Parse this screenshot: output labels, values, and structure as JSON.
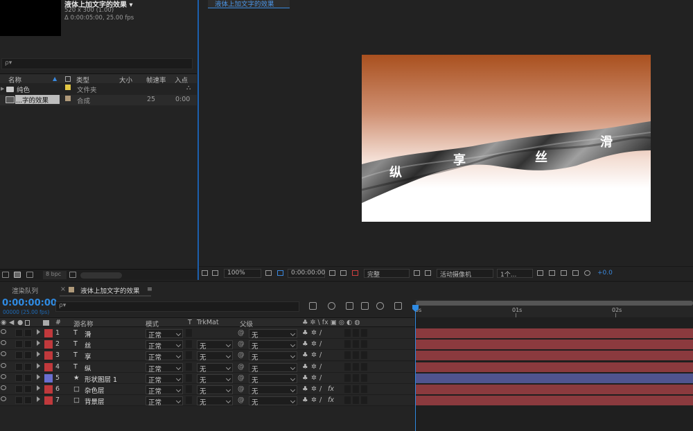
{
  "project": {
    "comp_title": "液体上加文字的效果 ▾",
    "comp_size": "520 x 300 (1.00)",
    "comp_duration": "Δ 0:00:05:00, 25.00 fps",
    "search_placeholder": "ρ▾",
    "headers": {
      "name": "名称",
      "type": "类型",
      "size": "大小",
      "fps": "帧速率",
      "in": "入点"
    },
    "items": [
      {
        "name": "纯色",
        "type": "文件夹",
        "fps": "",
        "in": "",
        "color": "#e3c744"
      },
      {
        "name": "...字的效果",
        "type": "合成",
        "fps": "25",
        "in": "0:00",
        "color": "#b09a7a"
      }
    ],
    "bpc": "8 bpc"
  },
  "viewer": {
    "tab": "液体上加文字的效果",
    "zoom": "100%",
    "timecode": "0:00:00:00",
    "resolution": "完整",
    "camera": "活动摄像机",
    "views": "1个...",
    "exposure": "+0.0",
    "canvas_chars": [
      "纵",
      "享",
      "丝",
      "滑"
    ]
  },
  "timeline": {
    "tabs": {
      "render_queue": "渲染队列",
      "comp": "液体上加文字的效果",
      "menu": "≡",
      "close": "×"
    },
    "current_time": "0:00:00:00",
    "fps_label": "00000 (25.00 fps)",
    "search_placeholder": "ρ▾",
    "headers": {
      "num": "#",
      "source": "源名称",
      "mode": "模式",
      "t": "T",
      "trkmat": "TrkMat",
      "parent": "父级"
    },
    "ruler": [
      "0s",
      "01s",
      "02s"
    ],
    "layers": [
      {
        "num": "1",
        "kind": "T",
        "name": "滑",
        "mode": "正常",
        "trkmat": "",
        "parent": "无",
        "color": "#c0393c",
        "bar": "#8b3a3e"
      },
      {
        "num": "2",
        "kind": "T",
        "name": "丝",
        "mode": "正常",
        "trkmat": "无",
        "parent": "无",
        "color": "#c0393c",
        "bar": "#8b3a3e"
      },
      {
        "num": "3",
        "kind": "T",
        "name": "享",
        "mode": "正常",
        "trkmat": "无",
        "parent": "无",
        "color": "#c0393c",
        "bar": "#8b3a3e"
      },
      {
        "num": "4",
        "kind": "T",
        "name": "纵",
        "mode": "正常",
        "trkmat": "无",
        "parent": "无",
        "color": "#c0393c",
        "bar": "#8b3a3e"
      },
      {
        "num": "5",
        "kind": "★",
        "name": "形状图层 1",
        "mode": "正常",
        "trkmat": "无",
        "parent": "无",
        "color": "#6a6fd0",
        "bar": "#50548f"
      },
      {
        "num": "6",
        "kind": "□",
        "name": "杂色层",
        "mode": "正常",
        "trkmat": "无",
        "parent": "无",
        "color": "#c0393c",
        "bar": "#8b3a3e"
      },
      {
        "num": "7",
        "kind": "□",
        "name": "背景层",
        "mode": "正常",
        "trkmat": "无",
        "parent": "无",
        "color": "#c0393c",
        "bar": "#8b3a3e"
      }
    ]
  }
}
